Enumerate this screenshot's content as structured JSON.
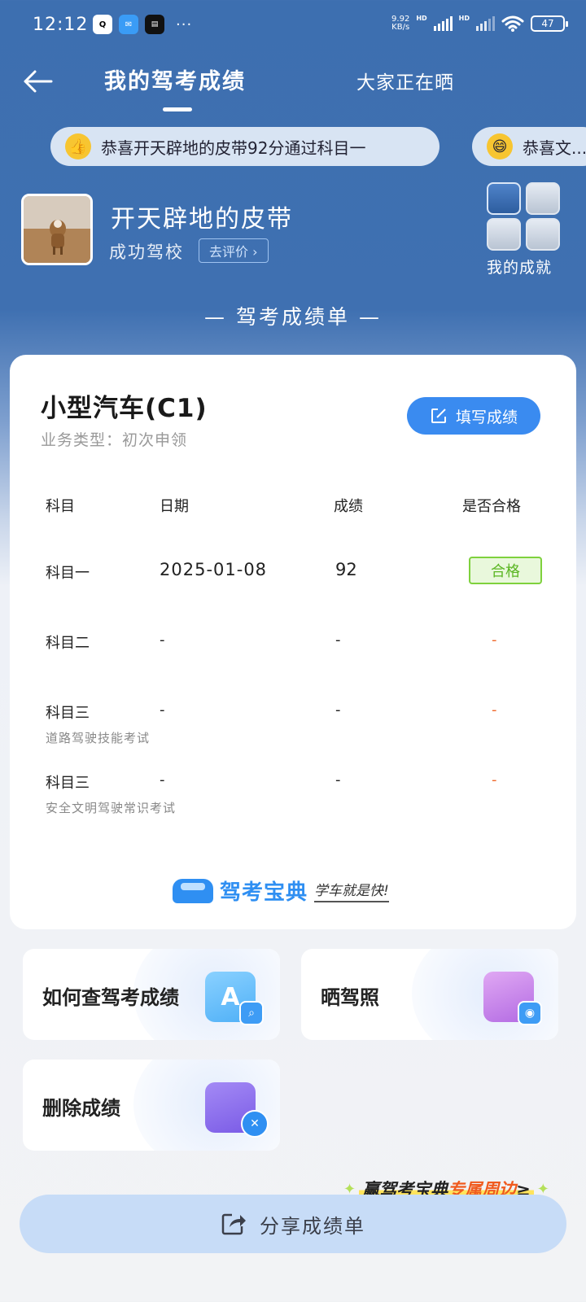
{
  "status_bar": {
    "time": "12:12",
    "more": "···",
    "net_speed_value": "9.92",
    "net_speed_unit": "KB/s",
    "hd1": "HD",
    "hd2": "HD",
    "battery": "47",
    "app_icons": [
      "qq-icon",
      "message-icon",
      "news-app-icon"
    ]
  },
  "nav": {
    "tab_active": "我的驾考成绩",
    "tab_other": "大家正在晒"
  },
  "marquee": [
    {
      "emoji_icon": "thumbs-up-icon",
      "text": "恭喜开天辟地的皮带92分通过科目一"
    },
    {
      "emoji_icon": "smile-icon",
      "text": "恭喜文..."
    }
  ],
  "profile": {
    "name": "开天辟地的皮带",
    "school": "成功驾校",
    "rate_label": "去评价 ›",
    "achievements_label": "我的成就"
  },
  "section_title": "— 驾考成绩单 —",
  "card": {
    "car_type": "小型汽车(C1)",
    "business_type": "业务类型：初次申领",
    "fill_button": "填写成绩",
    "headers": [
      "科目",
      "日期",
      "成绩",
      "是否合格"
    ],
    "rows": [
      {
        "subject": "科目一",
        "subtitle": "",
        "date": "2025-01-08",
        "score": "92",
        "pass": "合格"
      },
      {
        "subject": "科目二",
        "subtitle": "",
        "date": "-",
        "score": "-",
        "pass": "-"
      },
      {
        "subject": "科目三",
        "subtitle": "道路驾驶技能考试",
        "date": "-",
        "score": "-",
        "pass": "-"
      },
      {
        "subject": "科目三",
        "subtitle": "安全文明驾驶常识考试",
        "date": "-",
        "score": "-",
        "pass": "-"
      }
    ],
    "brand_name": "驾考宝典",
    "brand_slogan": "学车就是快!"
  },
  "actions": {
    "query": "如何查驾考成绩",
    "show_license": "晒驾照",
    "delete": "删除成绩"
  },
  "promo": {
    "part1": "赢驾考宝典",
    "part2": "专属周边",
    "part3": "≥"
  },
  "share_button": "分享成绩单",
  "colors": {
    "header_blue": "#3d6fb0",
    "accent": "#3a8bf0",
    "pass_green": "#5bb623",
    "fail_orange": "#f06a2d"
  }
}
